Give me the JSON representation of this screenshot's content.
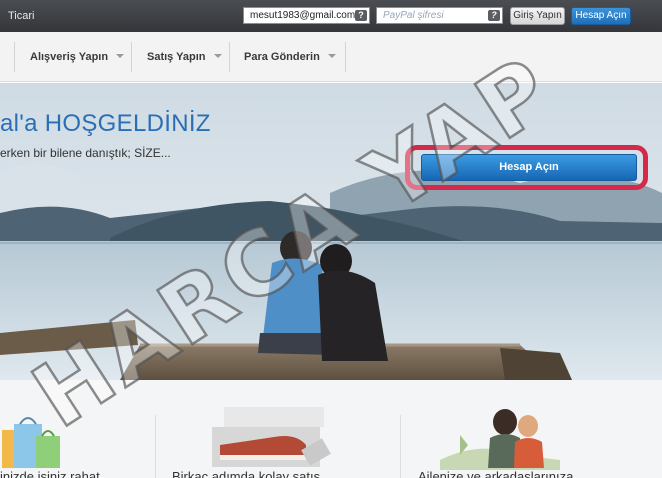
{
  "topbar": {
    "link": "Ticari",
    "email_value": "mesut1983@gmail.com",
    "password_placeholder": "PayPal şifresi",
    "help_label": "?",
    "login_button": "Giriş Yapın",
    "signup_button": "Hesap Açın"
  },
  "nav": {
    "items": [
      {
        "label": "Alışveriş Yapın"
      },
      {
        "label": "Satış Yapın"
      },
      {
        "label": "Para Gönderin"
      }
    ]
  },
  "hero": {
    "title": "al'a HOŞGELDİNİZ",
    "subtitle": "erken bir bilene danıştık; SİZE...",
    "button": "Hesap Açın",
    "highlight_color": "#d6284a"
  },
  "features": [
    {
      "text": "inizde işiniz rahat",
      "icon": "shopping-bags-icon"
    },
    {
      "text": "Birkaç adımda kolay satış",
      "icon": "shoe-box-sale-icon"
    },
    {
      "text": "Ailenize ve arkadaşlarınıza",
      "icon": "family-icon"
    }
  ],
  "watermark": {
    "text": "HARCA YAP"
  },
  "colors": {
    "brand_blue": "#2a6fb5",
    "button_blue": "#1f6fb8",
    "topbar": "#3d4044"
  }
}
